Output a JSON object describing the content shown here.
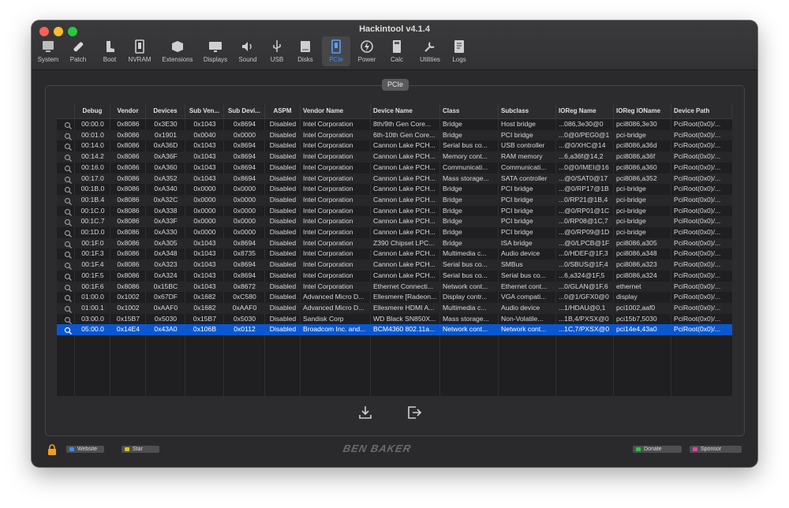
{
  "window": {
    "title": "Hackintool v4.1.4"
  },
  "toolbar": {
    "items": [
      {
        "label": "System",
        "icon": "system-icon"
      },
      {
        "label": "Patch",
        "icon": "patch-icon"
      },
      {
        "label": "Boot",
        "icon": "boot-icon"
      },
      {
        "label": "NVRAM",
        "icon": "nvram-icon"
      },
      {
        "label": "Extensions",
        "icon": "extensions-icon"
      },
      {
        "label": "Displays",
        "icon": "displays-icon"
      },
      {
        "label": "Sound",
        "icon": "sound-icon"
      },
      {
        "label": "USB",
        "icon": "usb-icon"
      },
      {
        "label": "Disks",
        "icon": "disks-icon"
      },
      {
        "label": "PCIe",
        "icon": "pcie-icon"
      },
      {
        "label": "Power",
        "icon": "power-icon"
      },
      {
        "label": "Calc",
        "icon": "calc-icon"
      },
      {
        "label": "Utilities",
        "icon": "utilities-icon"
      },
      {
        "label": "Logs",
        "icon": "logs-icon"
      }
    ],
    "active": "PCIe"
  },
  "panel": {
    "tab_label": "PCIe"
  },
  "table": {
    "columns": [
      "",
      "Debug",
      "Vendor",
      "Devices",
      "Sub Ven...",
      "Sub Devi...",
      "ASPM",
      "Vendor Name",
      "Device Name",
      "Class",
      "Subclass",
      "IOReg Name",
      "IOReg IOName",
      "Device Path"
    ],
    "rows": [
      [
        "00:00.0",
        "0x8086",
        "0x3E30",
        "0x1043",
        "0x8694",
        "Disabled",
        "Intel Corporation",
        "8th/9th Gen Core...",
        "Bridge",
        "Host bridge",
        "...086,3e30@0",
        "pci8086,3e30",
        "PciRoot(0x0)/..."
      ],
      [
        "00:01.0",
        "0x8086",
        "0x1901",
        "0x0040",
        "0x0000",
        "Disabled",
        "Intel Corporation",
        "6th-10th Gen Core...",
        "Bridge",
        "PCI bridge",
        "...0@0/PEG0@1",
        "pci-bridge",
        "PciRoot(0x0)/..."
      ],
      [
        "00:14.0",
        "0x8086",
        "0xA36D",
        "0x1043",
        "0x8694",
        "Disabled",
        "Intel Corporation",
        "Cannon Lake PCH...",
        "Serial bus co...",
        "USB controller",
        "...@0/XHC@14",
        "pci8086,a36d",
        "PciRoot(0x0)/..."
      ],
      [
        "00:14.2",
        "0x8086",
        "0xA36F",
        "0x1043",
        "0x8694",
        "Disabled",
        "Intel Corporation",
        "Cannon Lake PCH...",
        "Memory cont...",
        "RAM memory",
        "...6,a36f@14,2",
        "pci8086,a36f",
        "PciRoot(0x0)/..."
      ],
      [
        "00:16.0",
        "0x8086",
        "0xA360",
        "0x1043",
        "0x8694",
        "Disabled",
        "Intel Corporation",
        "Cannon Lake PCH...",
        "Communicati...",
        "Communicati...",
        "...0@0/IMEI@16",
        "pci8086,a360",
        "PciRoot(0x0)/..."
      ],
      [
        "00:17.0",
        "0x8086",
        "0xA352",
        "0x1043",
        "0x8694",
        "Disabled",
        "Intel Corporation",
        "Cannon Lake PCH...",
        "Mass storage...",
        "SATA controller",
        "...@0/SAT0@17",
        "pci8086,a352",
        "PciRoot(0x0)/..."
      ],
      [
        "00:1B.0",
        "0x8086",
        "0xA340",
        "0x0000",
        "0x0000",
        "Disabled",
        "Intel Corporation",
        "Cannon Lake PCH...",
        "Bridge",
        "PCI bridge",
        "...@0/RP17@1B",
        "pci-bridge",
        "PciRoot(0x0)/..."
      ],
      [
        "00:1B.4",
        "0x8086",
        "0xA32C",
        "0x0000",
        "0x0000",
        "Disabled",
        "Intel Corporation",
        "Cannon Lake PCH...",
        "Bridge",
        "PCI bridge",
        "...0/RP21@1B,4",
        "pci-bridge",
        "PciRoot(0x0)/..."
      ],
      [
        "00:1C.0",
        "0x8086",
        "0xA338",
        "0x0000",
        "0x0000",
        "Disabled",
        "Intel Corporation",
        "Cannon Lake PCH...",
        "Bridge",
        "PCI bridge",
        "...@0/RP01@1C",
        "pci-bridge",
        "PciRoot(0x0)/..."
      ],
      [
        "00:1C.7",
        "0x8086",
        "0xA33F",
        "0x0000",
        "0x0000",
        "Disabled",
        "Intel Corporation",
        "Cannon Lake PCH...",
        "Bridge",
        "PCI bridge",
        "...0/RP08@1C,7",
        "pci-bridge",
        "PciRoot(0x0)/..."
      ],
      [
        "00:1D.0",
        "0x8086",
        "0xA330",
        "0x0000",
        "0x0000",
        "Disabled",
        "Intel Corporation",
        "Cannon Lake PCH...",
        "Bridge",
        "PCI bridge",
        "...@0/RP09@1D",
        "pci-bridge",
        "PciRoot(0x0)/..."
      ],
      [
        "00:1F.0",
        "0x8086",
        "0xA305",
        "0x1043",
        "0x8694",
        "Disabled",
        "Intel Corporation",
        "Z390 Chipset LPC...",
        "Bridge",
        "ISA bridge",
        "...@0/LPCB@1F",
        "pci8086,a305",
        "PciRoot(0x0)/..."
      ],
      [
        "00:1F.3",
        "0x8086",
        "0xA348",
        "0x1043",
        "0x8735",
        "Disabled",
        "Intel Corporation",
        "Cannon Lake PCH...",
        "Multimedia c...",
        "Audio device",
        "...0/HDEF@1F,3",
        "pci8086,a348",
        "PciRoot(0x0)/..."
      ],
      [
        "00:1F.4",
        "0x8086",
        "0xA323",
        "0x1043",
        "0x8694",
        "Disabled",
        "Intel Corporation",
        "Cannon Lake PCH...",
        "Serial bus co...",
        "SMBus",
        "...0/SBUS@1F,4",
        "pci8086,a323",
        "PciRoot(0x0)/..."
      ],
      [
        "00:1F.5",
        "0x8086",
        "0xA324",
        "0x1043",
        "0x8694",
        "Disabled",
        "Intel Corporation",
        "Cannon Lake PCH...",
        "Serial bus co...",
        "Serial bus co...",
        "...6,a324@1F,5",
        "pci8086,a324",
        "PciRoot(0x0)/..."
      ],
      [
        "00:1F.6",
        "0x8086",
        "0x15BC",
        "0x1043",
        "0x8672",
        "Disabled",
        "Intel Corporation",
        "Ethernet Connecti...",
        "Network cont...",
        "Ethernet cont...",
        "...0/GLAN@1F,6",
        "ethernet",
        "PciRoot(0x0)/..."
      ],
      [
        "01:00.0",
        "0x1002",
        "0x67DF",
        "0x1682",
        "0xC580",
        "Disabled",
        "Advanced Micro D...",
        "Ellesmere [Radeon...",
        "Display contr...",
        "VGA compati...",
        "...0@1/GFX0@0",
        "display",
        "PciRoot(0x0)/..."
      ],
      [
        "01:00.1",
        "0x1002",
        "0xAAF0",
        "0x1682",
        "0xAAF0",
        "Disabled",
        "Advanced Micro D...",
        "Ellesmere HDMI A...",
        "Multimedia c...",
        "Audio device",
        "...1/HDAU@0,1",
        "pci1002,aaf0",
        "PciRoot(0x0)/..."
      ],
      [
        "03:00.0",
        "0x15B7",
        "0x5030",
        "0x15B7",
        "0x5030",
        "Disabled",
        "Sandisk Corp",
        "WD Black SN850X...",
        "Mass storage...",
        "Non-Volatile...",
        "...1B,4/PXSX@0",
        "pci15b7,5030",
        "PciRoot(0x0)/..."
      ],
      [
        "05:00.0",
        "0x14E4",
        "0x43A0",
        "0x106B",
        "0x0112",
        "Disabled",
        "Broadcom Inc. and...",
        "BCM4360 802.11a...",
        "Network cont...",
        "Network cont...",
        "...1C,7/PXSX@0",
        "pci14e4,43a0",
        "PciRoot(0x0)/..."
      ]
    ],
    "selected_row": 19
  },
  "actions": {
    "export_icon": "download-icon",
    "exit_icon": "exit-icon"
  },
  "footer": {
    "lock_icon": "lock-icon",
    "website_label": "Website",
    "star_label": "Star",
    "brand_text": "BEN BAKER",
    "donate_label": "Donate",
    "sponsor_label": "Sponsor"
  },
  "colors": {
    "selection": "#0b57d0",
    "accent": "#3d8cff",
    "window_bg": "#2a2a2c"
  }
}
